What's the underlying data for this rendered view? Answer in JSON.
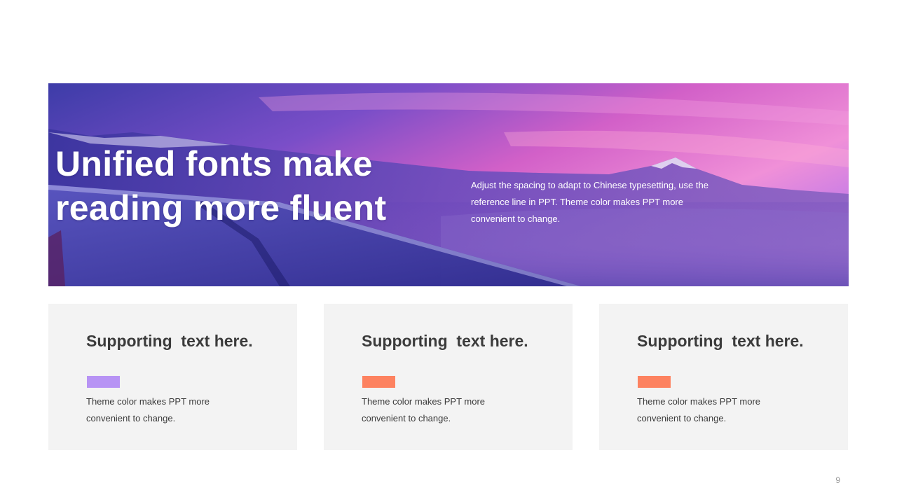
{
  "hero": {
    "title": "Unified fonts make reading more fluent",
    "description": "Adjust the spacing to adapt to Chinese typesetting, use the reference line in PPT. Theme color makes PPT more convenient to change."
  },
  "cards": [
    {
      "title": "Supporting  text here.",
      "accent_color": "#b793f4",
      "text": "Theme color makes PPT more convenient  to change."
    },
    {
      "title": "Supporting  text here.",
      "accent_color": "#fd8260",
      "text": "Theme color makes PPT more convenient  to change."
    },
    {
      "title": "Supporting  text here.",
      "accent_color": "#fd8260",
      "text": "Theme color makes PPT more convenient  to change."
    }
  ],
  "page_number": "9"
}
